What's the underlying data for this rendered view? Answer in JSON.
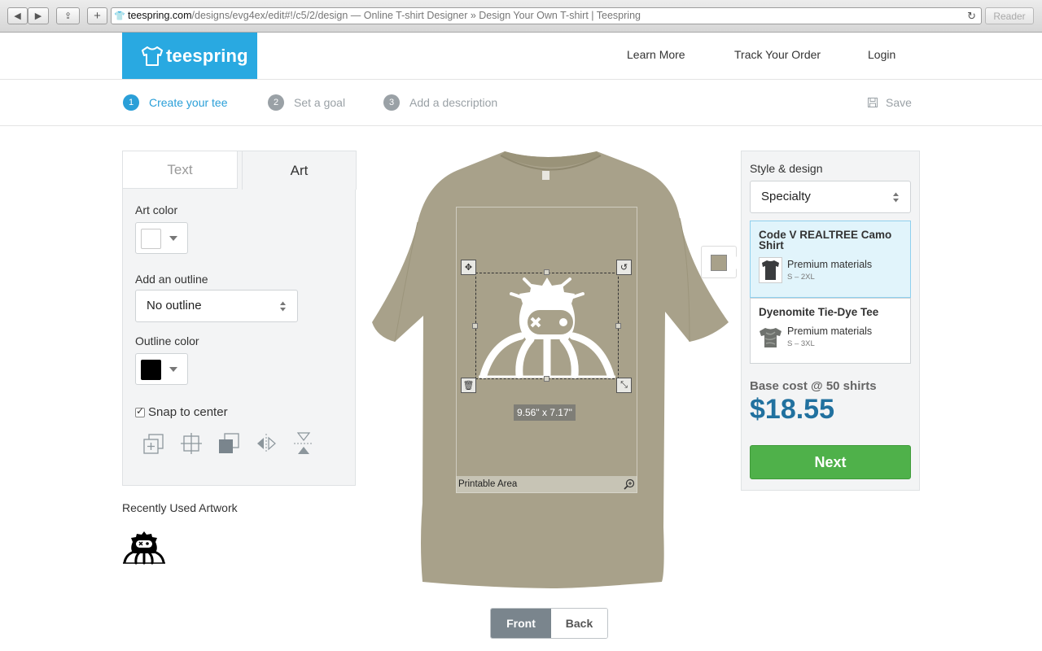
{
  "browser": {
    "url_host": "teespring.com",
    "url_path": "/designs/evg4ex/edit#!/c5/2/design",
    "page_title": " — Online T-shirt Designer » Design Your Own T-shirt | Teespring",
    "reader_label": "Reader"
  },
  "header": {
    "logo_text": "teespring",
    "nav": [
      "Learn More",
      "Track Your Order",
      "Login"
    ]
  },
  "steps": [
    {
      "num": "1",
      "label": "Create your tee",
      "active": true
    },
    {
      "num": "2",
      "label": "Set a goal",
      "active": false
    },
    {
      "num": "3",
      "label": "Add a description",
      "active": false
    }
  ],
  "save_label": "Save",
  "left_panel": {
    "tabs": [
      "Text",
      "Art"
    ],
    "active_tab": "Art",
    "art_color_label": "Art color",
    "art_color": "#ffffff",
    "outline_label": "Add an outline",
    "outline_value": "No outline",
    "outline_color_label": "Outline color",
    "outline_color": "#000000",
    "snap_label": "Snap to center",
    "snap_checked": true
  },
  "recent": {
    "title": "Recently Used Artwork"
  },
  "canvas": {
    "shirt_color": "#a8a18a",
    "dimensions": "9.56\" x 7.17\"",
    "printable_label": "Printable Area",
    "views": [
      "Front",
      "Back"
    ],
    "active_view": "Front"
  },
  "right_panel": {
    "style_title": "Style & design",
    "style_value": "Specialty",
    "products": [
      {
        "name": "Code V REALTREE Camo Shirt",
        "material": "Premium materials",
        "sizes": "S – 2XL",
        "selected": true
      },
      {
        "name": "Dyenomite Tie-Dye Tee",
        "material": "Premium materials",
        "sizes": "S – 3XL",
        "selected": false
      }
    ],
    "base_cost_label": "Base cost @ 50 shirts",
    "price": "$18.55",
    "next_label": "Next"
  },
  "colors": {
    "brand_blue": "#29a9e1",
    "active_step": "#2a9fd8",
    "price_blue": "#21719f",
    "next_green": "#4fb14a"
  }
}
